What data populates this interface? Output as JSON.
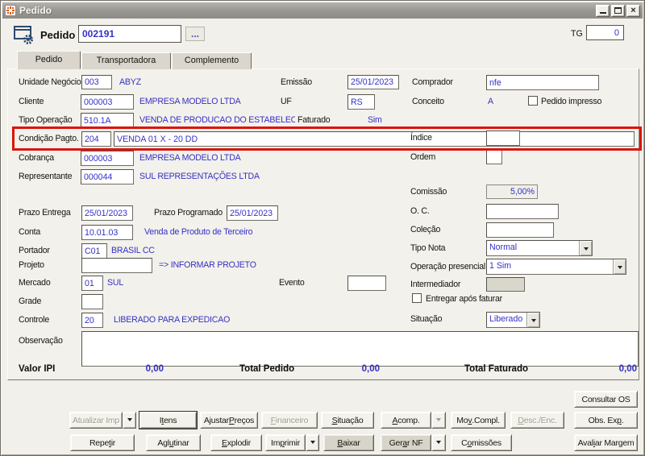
{
  "window": {
    "title": "Pedido"
  },
  "colors": {
    "value_blue": "#3431c6",
    "annotation_red": "#d9150e",
    "titlebar_gray": "#9b9993",
    "body_bg": "#f2f0ea"
  },
  "header": {
    "entity_label": "Pedido",
    "order_number": "002191",
    "browse_label": "...",
    "tg_label": "TG",
    "tg_value": "0"
  },
  "tabs": [
    {
      "label": "Pedido"
    },
    {
      "label": "Transportadora"
    },
    {
      "label": "Complemento"
    }
  ],
  "form": {
    "unidade_negocio": {
      "label": "Unidade Negócio",
      "code": "003",
      "desc": "ABYZ"
    },
    "cliente": {
      "label": "Cliente",
      "code": "000003",
      "desc": "EMPRESA MODELO LTDA"
    },
    "tipo_operacao": {
      "label": "Tipo Operação",
      "code": "510.1A",
      "desc": "VENDA DE PRODUCAO DO ESTABELECIMEI"
    },
    "faturado": {
      "label": "Faturado",
      "value": "Sim"
    },
    "emissao": {
      "label": "Emissão",
      "value": "25/01/2023"
    },
    "uf": {
      "label": "UF",
      "value": "RS"
    },
    "comprador": {
      "label": "Comprador",
      "value": "nfe"
    },
    "conceito": {
      "label": "Conceito",
      "value": "A"
    },
    "pedido_impresso": {
      "label": "Pedido impresso",
      "checked": false
    },
    "condicao_pagto": {
      "label": "Condição Pagto.",
      "code": "204",
      "desc": "VENDA 01 X - 20 DD"
    },
    "cobranca": {
      "label": "Cobrança",
      "code": "000003",
      "desc": "EMPRESA MODELO LTDA"
    },
    "representante": {
      "label": "Representante",
      "code": "000044",
      "desc": "SUL REPRESENTAÇÕES LTDA"
    },
    "indice": {
      "label": "Índice",
      "value": ""
    },
    "ordem": {
      "label": "Ordem",
      "value": ""
    },
    "comissao": {
      "label": "Comissão",
      "value": "5,00%"
    },
    "prazo_entrega": {
      "label": "Prazo Entrega",
      "value": "25/01/2023"
    },
    "prazo_programado": {
      "label": "Prazo Programado",
      "value": "25/01/2023"
    },
    "oc": {
      "label": "O. C.",
      "value": ""
    },
    "conta": {
      "label": "Conta",
      "code": "10.01.03",
      "desc": "Venda de Produto de Terceiro"
    },
    "colecao": {
      "label": "Coleção",
      "value": ""
    },
    "portador": {
      "label": "Portador",
      "code": "C01",
      "desc": "BRASIL CC"
    },
    "tipo_nota": {
      "label": "Tipo Nota",
      "value": "Normal"
    },
    "projeto": {
      "label": "Projeto",
      "value": "",
      "hint": "=> INFORMAR PROJETO"
    },
    "operacao_presencial": {
      "label": "Operação presencial",
      "value": "1 Sim"
    },
    "mercado": {
      "label": "Mercado",
      "code": "01",
      "desc": "SUL"
    },
    "evento": {
      "label": "Evento",
      "value": ""
    },
    "intermediador": {
      "label": "Intermediador",
      "value": ""
    },
    "grade": {
      "label": "Grade",
      "value": ""
    },
    "entregar_apos_faturar": {
      "label": "Entregar após faturar",
      "checked": false
    },
    "controle": {
      "label": "Controle",
      "code": "20",
      "desc": "LIBERADO PARA EXPEDICAO"
    },
    "situacao": {
      "label": "Situação",
      "value": "Liberado"
    },
    "observacao": {
      "label": "Observação",
      "value": ""
    }
  },
  "totals": {
    "valor_ipi_label": "Valor IPI",
    "valor_ipi": "0,00",
    "total_pedido_label": "Total Pedido",
    "total_pedido": "0,00",
    "total_faturado_label": "Total Faturado",
    "total_faturado": "0,00"
  },
  "actions": {
    "consultar_os": {
      "label": "Consultar OS",
      "u": null
    },
    "atualizar_imp": {
      "label": "Atualizar Imp",
      "u": null,
      "disabled": true
    },
    "itens": {
      "label": "Itens",
      "u": 1,
      "default": true
    },
    "ajustar_precos": {
      "label": "Ajustar Preços",
      "u": 8
    },
    "financeiro": {
      "label": "Financeiro",
      "u": 0,
      "disabled": true
    },
    "situacao": {
      "label": "Situação",
      "u": 0
    },
    "acomp": {
      "label": "Acomp.",
      "u": 0
    },
    "mov_compl": {
      "label": "Mov.Compl.",
      "u": 2
    },
    "desc_enc": {
      "label": "Desc./Enc.",
      "u": 0,
      "disabled": true
    },
    "obs_exp": {
      "label": "Obs. Exp.",
      "u": 7
    },
    "repetir": {
      "label": "Repetir",
      "u": 4
    },
    "aglutinar": {
      "label": "Aglutinar",
      "u": 3
    },
    "explodir": {
      "label": "Explodir",
      "u": 0
    },
    "imprimir": {
      "label": "Imprimir",
      "u": 2
    },
    "baixar": {
      "label": "Baixar",
      "u": 0,
      "shaded": true
    },
    "gerar_nf": {
      "label": "Gerar NF",
      "u": 3,
      "shaded": true
    },
    "comissoes": {
      "label": "Comissões",
      "u": 1
    },
    "avaliar_margem": {
      "label": "Avaliar Margem",
      "u": 4
    }
  }
}
